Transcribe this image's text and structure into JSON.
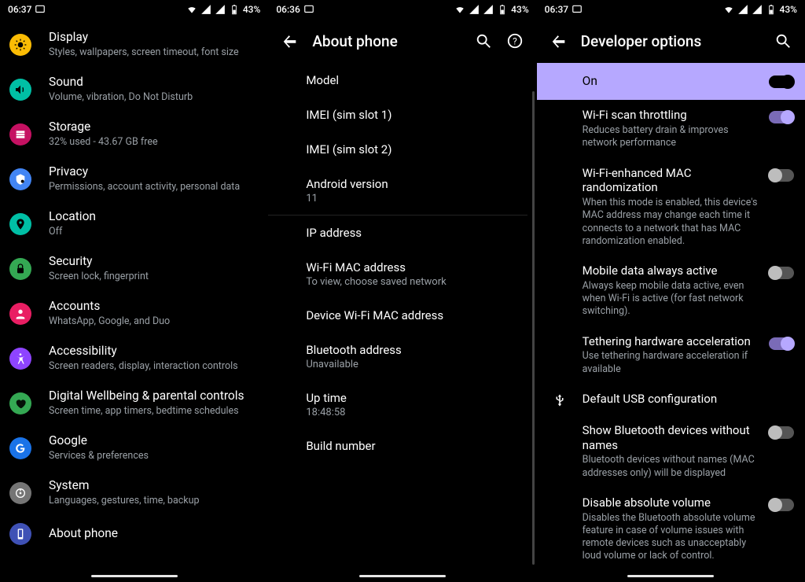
{
  "phone1": {
    "status": {
      "time": "06:37",
      "battery": "43%"
    },
    "items": [
      {
        "title": "Display",
        "sub": "Styles, wallpapers, screen timeout, font size",
        "bg": "#fbbc04",
        "icon": "display"
      },
      {
        "title": "Sound",
        "sub": "Volume, vibration, Do Not Disturb",
        "bg": "#00bfa5",
        "icon": "sound"
      },
      {
        "title": "Storage",
        "sub": "32% used - 43.67 GB free",
        "bg": "#c51162",
        "icon": "storage"
      },
      {
        "title": "Privacy",
        "sub": "Permissions, account activity, personal data",
        "bg": "#4285f4",
        "icon": "privacy"
      },
      {
        "title": "Location",
        "sub": "Off",
        "bg": "#00bfa5",
        "icon": "location"
      },
      {
        "title": "Security",
        "sub": "Screen lock, fingerprint",
        "bg": "#34a853",
        "icon": "security"
      },
      {
        "title": "Accounts",
        "sub": "WhatsApp, Google, and Duo",
        "bg": "#e91e63",
        "icon": "accounts"
      },
      {
        "title": "Accessibility",
        "sub": "Screen readers, display, interaction controls",
        "bg": "#8e44ff",
        "icon": "accessibility"
      },
      {
        "title": "Digital Wellbeing & parental controls",
        "sub": "Screen time, app timers, bedtime schedules",
        "bg": "#34a853",
        "icon": "wellbeing"
      },
      {
        "title": "Google",
        "sub": "Services & preferences",
        "bg": "#1a73e8",
        "icon": "google"
      },
      {
        "title": "System",
        "sub": "Languages, gestures, time, backup",
        "bg": "#757575",
        "icon": "system"
      },
      {
        "title": "About phone",
        "sub": "",
        "bg": "#3f51b5",
        "icon": "about"
      }
    ]
  },
  "phone2": {
    "status": {
      "time": "06:36",
      "battery": "43%"
    },
    "appbar": {
      "title": "About phone"
    },
    "items": [
      {
        "title": "Model"
      },
      {
        "title": "IMEI (sim slot 1)"
      },
      {
        "title": "IMEI (sim slot 2)"
      },
      {
        "title": "Android version",
        "sub": "11",
        "divider": true
      },
      {
        "title": "IP address"
      },
      {
        "title": "Wi-Fi MAC address",
        "sub": "To view, choose saved network"
      },
      {
        "title": "Device Wi-Fi MAC address"
      },
      {
        "title": "Bluetooth address",
        "sub": "Unavailable"
      },
      {
        "title": "Up time",
        "sub": "18:48:58"
      },
      {
        "title": "Build number"
      }
    ]
  },
  "phone3": {
    "status": {
      "time": "06:37",
      "battery": "43%"
    },
    "appbar": {
      "title": "Developer options"
    },
    "highlight": {
      "label": "On"
    },
    "items": [
      {
        "title": "Wi-Fi scan throttling",
        "sub": "Reduces battery drain & improves network performance",
        "on": true
      },
      {
        "title": "Wi-Fi-enhanced MAC randomization",
        "sub": "When this mode is enabled, this device's MAC address may change each time it connects to a network that has MAC randomization enabled.",
        "on": false
      },
      {
        "title": "Mobile data always active",
        "sub": "Always keep mobile data active, even when Wi-Fi is active (for fast network switching).",
        "on": false
      },
      {
        "title": "Tethering hardware acceleration",
        "sub": "Use tethering hardware acceleration if available",
        "on": true
      },
      {
        "title": "Default USB configuration",
        "icon": "usb"
      },
      {
        "title": "Show Bluetooth devices without names",
        "sub": "Bluetooth devices without names (MAC addresses only) will be displayed",
        "on": false
      },
      {
        "title": "Disable absolute volume",
        "sub": "Disables the Bluetooth absolute volume feature in case of volume issues with remote devices such as unacceptably loud volume or lack of control.",
        "on": false
      }
    ]
  }
}
